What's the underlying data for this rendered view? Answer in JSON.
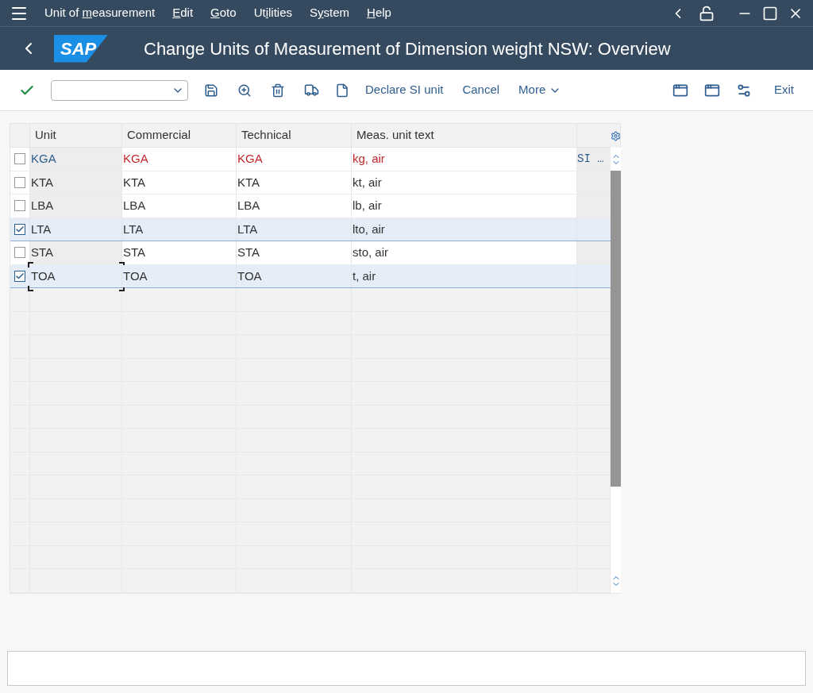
{
  "menu_bar": {
    "items": [
      {
        "before": "Unit of ",
        "mnemonic": "m",
        "after": "easurement"
      },
      {
        "mnemonic": "E",
        "after": "dit"
      },
      {
        "mnemonic": "G",
        "after": "oto"
      },
      {
        "before": "Ut",
        "mnemonic": "i",
        "after": "lities"
      },
      {
        "before": "S",
        "mnemonic": "y",
        "after": "stem"
      },
      {
        "mnemonic": "H",
        "after": "elp"
      }
    ]
  },
  "title_bar": {
    "logo": "SAP",
    "title": "Change Units of Measurement of Dimension weight NSW: Overview"
  },
  "toolbar": {
    "text_buttons": [
      "Declare SI unit",
      "Cancel"
    ],
    "more": "More",
    "exit": "Exit"
  },
  "table": {
    "columns": [
      "Unit",
      "Commercial",
      "Technical",
      "Meas. unit text"
    ],
    "rows": [
      {
        "checked": false,
        "selected": false,
        "highlighted": true,
        "focused": false,
        "cells": [
          "KGA",
          "KGA",
          "KGA",
          "kg, air"
        ],
        "column_6": "SI …"
      },
      {
        "checked": false,
        "selected": false,
        "highlighted": false,
        "focused": false,
        "cells": [
          "KTA",
          "KTA",
          "KTA",
          "kt, air"
        ]
      },
      {
        "checked": false,
        "selected": false,
        "highlighted": false,
        "focused": false,
        "cells": [
          "LBA",
          "LBA",
          "LBA",
          "lb, air"
        ]
      },
      {
        "checked": true,
        "selected": true,
        "highlighted": false,
        "focused": false,
        "cells": [
          "LTA",
          "LTA",
          "LTA",
          "lto, air"
        ]
      },
      {
        "checked": false,
        "selected": false,
        "highlighted": false,
        "focused": false,
        "cells": [
          "STA",
          "STA",
          "STA",
          "sto, air"
        ]
      },
      {
        "checked": true,
        "selected": true,
        "highlighted": false,
        "focused": true,
        "cells": [
          "TOA",
          "TOA",
          "TOA",
          "t, air"
        ]
      }
    ]
  }
}
